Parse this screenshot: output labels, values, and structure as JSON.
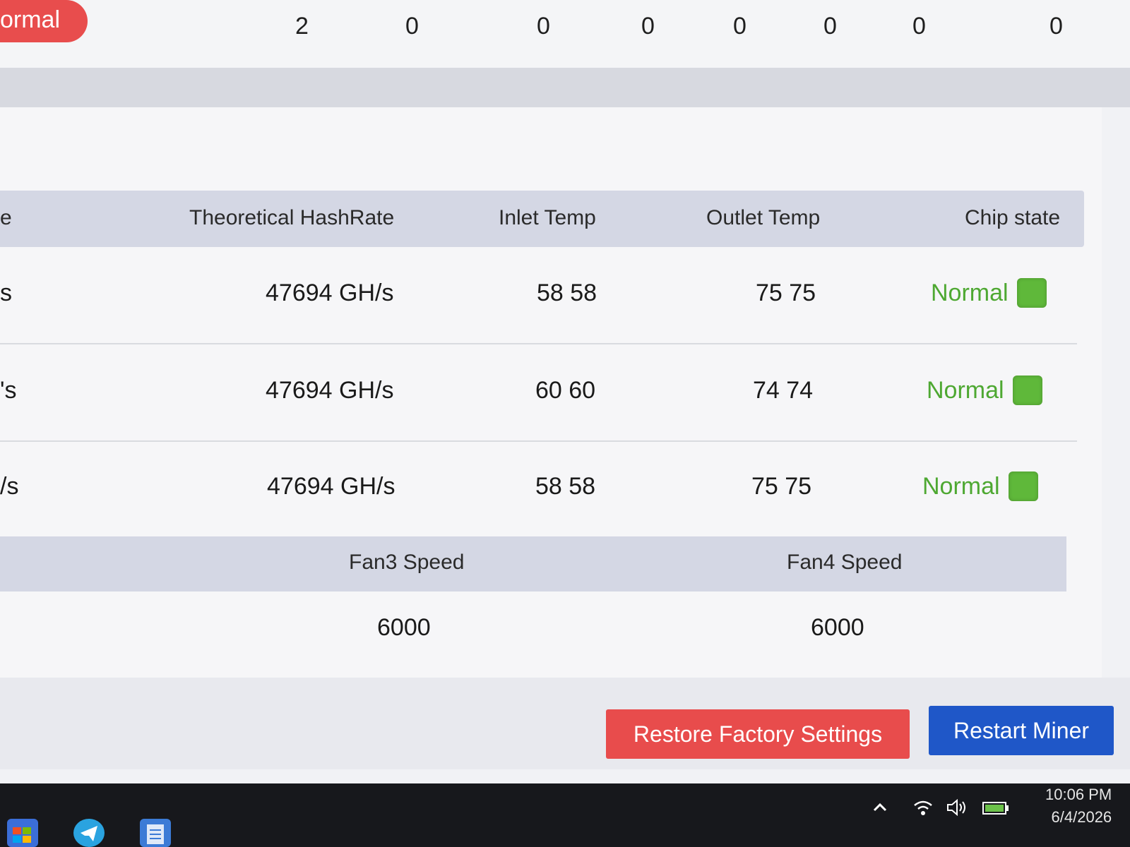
{
  "top_row": {
    "status_label": "ormal",
    "values": [
      "2",
      "0",
      "0",
      "0",
      "0",
      "0",
      "0",
      "0"
    ]
  },
  "table": {
    "headers": {
      "partial": "e",
      "theoretical_hashrate": "Theoretical HashRate",
      "inlet_temp": "Inlet Temp",
      "outlet_temp": "Outlet Temp",
      "chip_state": "Chip state"
    },
    "rows": [
      {
        "partial": "s",
        "hashrate": "47694 GH/s",
        "inlet": "58 58",
        "outlet": "75 75",
        "chip_state": "Normal"
      },
      {
        "partial": "'s",
        "hashrate": "47694 GH/s",
        "inlet": "60 60",
        "outlet": "74 74",
        "chip_state": "Normal"
      },
      {
        "partial": "/s",
        "hashrate": "47694 GH/s",
        "inlet": "58 58",
        "outlet": "75 75",
        "chip_state": "Normal"
      }
    ],
    "chip_ok_color": "#5fb83a"
  },
  "fans": {
    "fan3_label": "Fan3 Speed",
    "fan4_label": "Fan4 Speed",
    "fan3_value": "6000",
    "fan4_value": "6000"
  },
  "buttons": {
    "restore_label": "Restore Factory Settings",
    "restart_label": "Restart Miner"
  },
  "taskbar": {
    "time": "10:06 PM",
    "date": "6/4/2026",
    "icons": [
      "store-icon",
      "telegram-icon",
      "notepad-icon"
    ],
    "tray_icons": [
      "chevron-up-icon",
      "wifi-icon",
      "volume-icon",
      "battery-icon"
    ]
  },
  "colors": {
    "accent_red": "#e84c4c",
    "accent_blue": "#1f57c8",
    "status_green": "#4ea832"
  }
}
